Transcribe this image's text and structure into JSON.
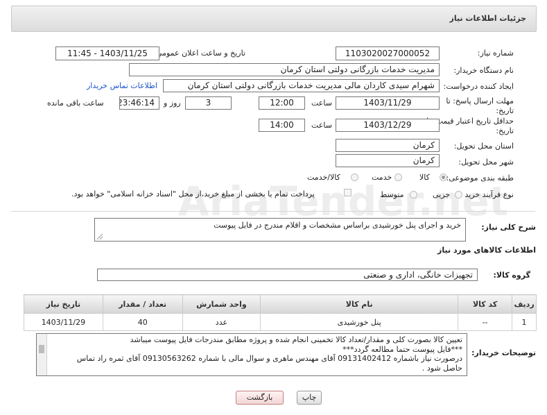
{
  "header": {
    "title": "جزئیات اطلاعات نیاز"
  },
  "form": {
    "need_number": {
      "label": "شماره نیاز:",
      "value": "1103020027000052"
    },
    "announce": {
      "label": "تاریخ و ساعت اعلان عمومی:",
      "value": "1403/11/25 - 11:45"
    },
    "buyer_org": {
      "label": "نام دستگاه خریدار:",
      "value": "مدیریت خدمات بازرگانی دولتی استان کرمان"
    },
    "requester": {
      "label": "ایجاد کننده درخواست:",
      "value": "شهرام سیدی کاردان مالی مدیریت خدمات بازرگانی دولتی استان کرمان",
      "contact_link": "اطلاعات تماس خریدار"
    },
    "deadline": {
      "label": "مهلت ارسال پاسخ: تا تاریخ:",
      "date": "1403/11/29",
      "time_label": "ساعت",
      "time": "12:00",
      "days": "3",
      "days_label": "روز و",
      "remaining": "23:46:14",
      "remaining_label": "ساعت باقی مانده"
    },
    "validity": {
      "label": "حداقل تاریخ اعتبار قیمت: تا تاریخ:",
      "date": "1403/12/29",
      "time_label": "ساعت",
      "time": "14:00"
    },
    "province": {
      "label": "استان محل تحویل:",
      "value": "کرمان"
    },
    "city": {
      "label": "شهر محل تحویل:",
      "value": "کرمان"
    },
    "category": {
      "label": "طبقه بندی موضوعی:",
      "options": [
        "کالا",
        "خدمت",
        "کالا/خدمت"
      ],
      "selected": "کالا"
    },
    "purchase_type": {
      "label": "نوع فرآیند خرید :",
      "options": [
        "جزیی",
        "متوسط"
      ],
      "selected": "",
      "payment_note": "پرداخت تمام یا بخشی از مبلغ خرید،از محل \"اسناد خزانه اسلامی\" خواهد بود."
    },
    "description": {
      "label": "شرح کلی نیاز:",
      "value": "خرید و اجرای پنل خورشیدی براساس مشخصات و اقلام مندرج در فایل پیوست"
    }
  },
  "goods": {
    "section_title": "اطلاعات کالاهای مورد نیاز",
    "group_label": "گروه کالا:",
    "group_value": "تجهیزات خانگی، اداری و صنعتی",
    "columns": [
      "ردیف",
      "کد کالا",
      "نام کالا",
      "واحد شمارش",
      "تعداد / مقدار",
      "تاریخ نیاز"
    ],
    "rows": [
      [
        "1",
        "--",
        "پنل خورشیدی",
        "عدد",
        "40",
        "1403/11/29"
      ]
    ]
  },
  "buyer_notes": {
    "label": "توضیحات خریدار:",
    "lines": [
      "تعیین کالا بصورت کلی و مقدار/تعداد کالا تخمینی انجام شده و پروژه مطابق مندرجات فایل پیوست میباشد",
      "***فایل پیوست حتما مطالعه گردد***",
      "درصورت نیاز باشماره  09131402412  آقای مهندس ماهری و سوال مالی با شماره 09130563262 آقای ثمره راد تماس",
      "حاصل شود ."
    ]
  },
  "buttons": {
    "print": "چاپ",
    "back": "بازگشت"
  },
  "watermark": "AriaTender.net"
}
